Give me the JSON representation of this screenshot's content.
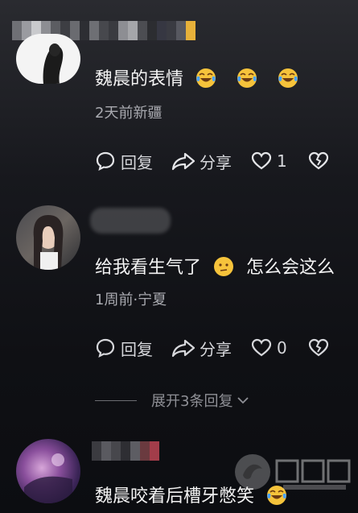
{
  "comments": [
    {
      "text": "魏晨的表情",
      "meta": "2天前新疆",
      "reply_label": "回复",
      "share_label": "分享",
      "like_count": "1",
      "emojis": [
        "laugh-cry-emoji",
        "laugh-cry-emoji",
        "laugh-cry-emoji"
      ]
    },
    {
      "text": "给我看生气了",
      "text_after_emoji": "怎么会这么",
      "meta": "1周前·宁夏",
      "reply_label": "回复",
      "share_label": "分享",
      "like_count": "0",
      "emojis": [
        "neutral-face-emoji"
      ]
    },
    {
      "text": "魏晨咬着后槽牙憋笑",
      "emojis": [
        "laugh-cry-emoji"
      ]
    }
  ],
  "expand_replies": "展开3条回复",
  "colors": {
    "emoji_yellow": "#f6c33b",
    "tear_blue": "#4aa3ff",
    "text_secondary": "#a9aab0"
  },
  "icons": [
    "comment-bubble-icon",
    "share-arrow-icon",
    "heart-icon",
    "dislike-heart-icon",
    "chevron-down-icon"
  ]
}
